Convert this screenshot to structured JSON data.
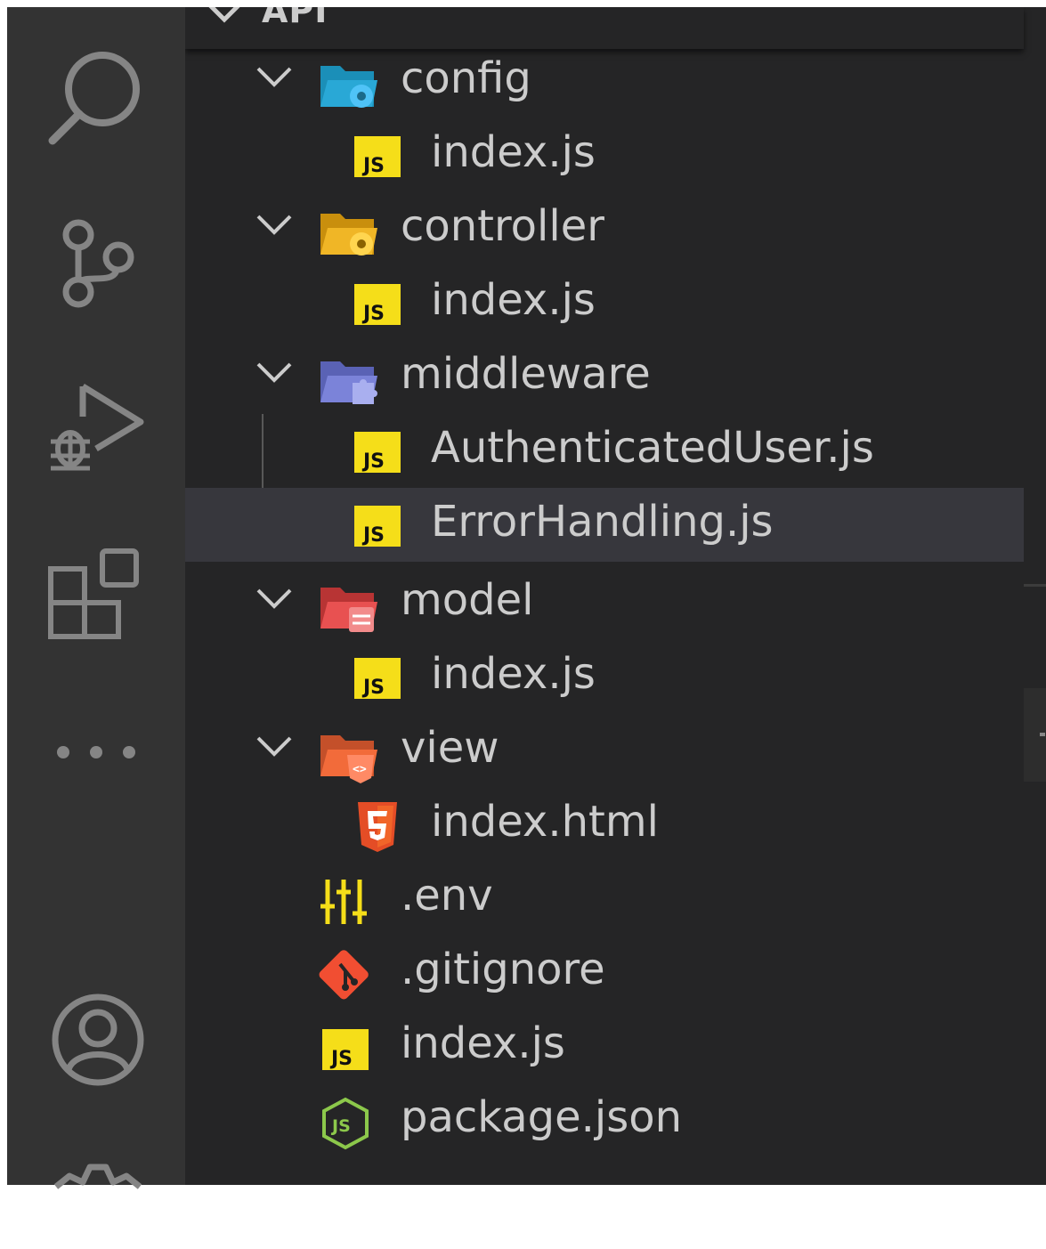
{
  "activity_bar": {
    "icons": [
      "search-icon",
      "source-control-icon",
      "run-debug-icon",
      "extensions-icon",
      "more-icon",
      "accounts-icon",
      "manage-gear-icon"
    ]
  },
  "explorer": {
    "section_title": "API",
    "tree": [
      {
        "label": "config",
        "type": "folder",
        "icon": "folder-config-icon",
        "color": "#29a8d6",
        "expanded": true
      },
      {
        "label": "index.js",
        "type": "file",
        "icon": "js-file-icon"
      },
      {
        "label": "controller",
        "type": "folder",
        "icon": "folder-controller-icon",
        "color": "#f0b626",
        "expanded": true
      },
      {
        "label": "index.js",
        "type": "file",
        "icon": "js-file-icon"
      },
      {
        "label": "middleware",
        "type": "folder",
        "icon": "folder-middleware-icon",
        "color": "#7b83d9",
        "expanded": true
      },
      {
        "label": "AuthenticatedUser.js",
        "type": "file",
        "icon": "js-file-icon"
      },
      {
        "label": "ErrorHandling.js",
        "type": "file",
        "icon": "js-file-icon",
        "selected": true
      },
      {
        "label": "model",
        "type": "folder",
        "icon": "folder-model-icon",
        "color": "#e85151",
        "expanded": true
      },
      {
        "label": "index.js",
        "type": "file",
        "icon": "js-file-icon"
      },
      {
        "label": "view",
        "type": "folder",
        "icon": "folder-view-icon",
        "color": "#f26b3a",
        "expanded": true
      },
      {
        "label": "index.html",
        "type": "file",
        "icon": "html5-icon"
      },
      {
        "label": ".env",
        "type": "file",
        "icon": "env-settings-icon"
      },
      {
        "label": ".gitignore",
        "type": "file",
        "icon": "git-icon"
      },
      {
        "label": "index.js",
        "type": "file",
        "icon": "js-file-icon"
      },
      {
        "label": "package.json",
        "type": "file",
        "icon": "nodejs-icon"
      }
    ]
  },
  "colors": {
    "js_badge": "#f5de19",
    "html5": "#e44d26",
    "git": "#f14e32",
    "env": "#f5de19",
    "nodejs": "#8cc84b",
    "selected_row": "#37373d"
  }
}
